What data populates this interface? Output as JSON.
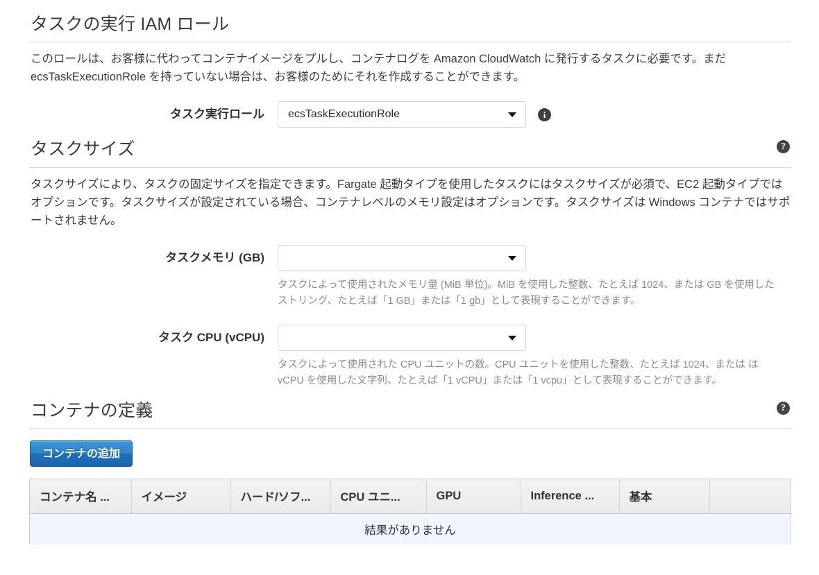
{
  "execution_role_section": {
    "heading": "タスクの実行 IAM ロール",
    "description": "このロールは、お客様に代わってコンテナイメージをプルし、コンテナログを Amazon CloudWatch に発行するタスクに必要です。まだ ecsTaskExecutionRole を持っていない場合は、お客様のためにそれを作成することができます。",
    "role_field": {
      "label": "タスク実行ロール",
      "value": "ecsTaskExecutionRole",
      "info_icon": "info-icon"
    }
  },
  "task_size_section": {
    "heading": "タスクサイズ",
    "help_icon": "help-icon",
    "description": "タスクサイズにより、タスクの固定サイズを指定できます。Fargate 起動タイプを使用したタスクにはタスクサイズが必須で、EC2 起動タイプではオプションです。タスクサイズが設定されている場合、コンテナレベルのメモリ設定はオプションです。タスクサイズは Windows コンテナではサポートされません。",
    "memory_field": {
      "label": "タスクメモリ (GB)",
      "value": "",
      "hint": "タスクによって使用されたメモリ量 (MiB 単位)。MiB を使用した整数、たとえば 1024、または GB を使用したストリング、たとえば「1 GB」または「1 gb」として表現することができます。"
    },
    "cpu_field": {
      "label": "タスク CPU (vCPU)",
      "value": "",
      "hint": "タスクによって使用された CPU ユニットの数。CPU ユニットを使用した整数、たとえば 1024、または は vCPU を使用した文字列、たとえば「1 vCPU」または「1 vcpu」として表現することができます。"
    }
  },
  "container_definitions_section": {
    "heading": "コンテナの定義",
    "help_icon": "help-icon",
    "add_button_label": "コンテナの追加",
    "table": {
      "columns": [
        "コンテナ名 ...",
        "イメージ",
        "ハード/ソフ...",
        "CPU ユニ...",
        "GPU",
        "Inference ...",
        "基本",
        ""
      ],
      "empty_message": "結果がありません"
    }
  },
  "colors": {
    "button_blue": "#2b84cc",
    "empty_row_blue": "#eef5fd",
    "badge_dark": "#3f3f3f",
    "rule_gray": "#d9d9d9"
  }
}
